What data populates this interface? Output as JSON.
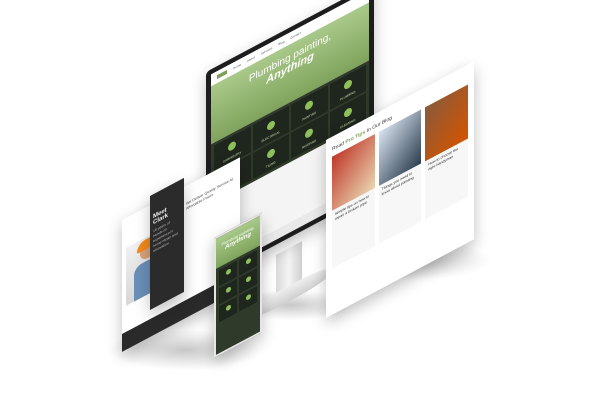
{
  "monitor": {
    "nav_items": [
      "Home",
      "About",
      "Services",
      "Blog",
      "Contact"
    ],
    "hero_line1": "Plumbing painting,",
    "hero_line2": "Anything",
    "tiles": [
      "CARPENTRY",
      "ELECTRICAL",
      "PAINTING",
      "PLUMBING",
      "REPAIRS",
      "TILING",
      "ROOFING",
      "CLEANING"
    ]
  },
  "blog": {
    "heading_pre": "Read",
    "heading_accent": "Pro Tips",
    "heading_post": "In Our Blog",
    "cards": [
      "Simple tips on how to repair a broken pipe",
      "Things you need to know about painting",
      "How to choose the right handyman"
    ],
    "card_colors": [
      "#c0392b",
      "#d7e2ef",
      "#8a5a3a"
    ]
  },
  "tablet": {
    "header": "We Deliver Quality Service At Affordable Prices"
  },
  "darkcard": {
    "title": "Meet Clark",
    "text": "18 years of hands-on experience in home repair and renovation"
  },
  "phone": {
    "hero_line1": "Plumbing painting,",
    "hero_line2": "Anything"
  },
  "colors": {
    "accent": "#7da05a",
    "dark": "#2b2b2b",
    "hero_green": "#a9c98a"
  }
}
